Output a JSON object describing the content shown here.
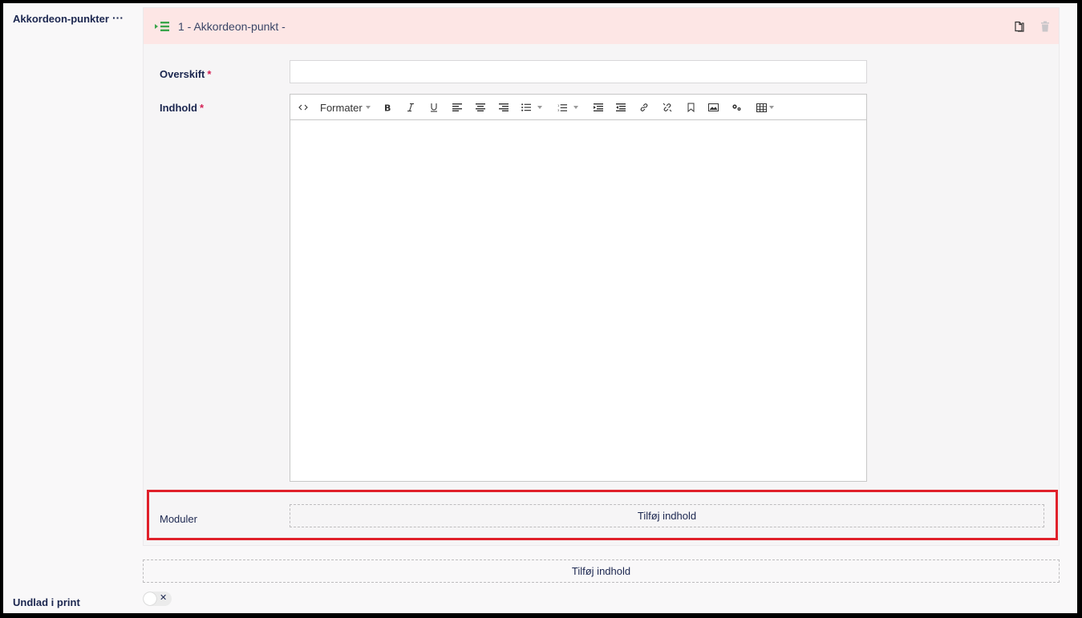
{
  "property": {
    "label": "Akkordeon-punkter",
    "more_label": "···"
  },
  "block": {
    "title": "1 - Akkordeon-punkt -",
    "fields": {
      "heading_label": "Overskift",
      "content_label": "Indhold",
      "required_mark": "*",
      "heading_value": "",
      "modules_label": "Moduler"
    },
    "editor": {
      "format_label": "Formater"
    },
    "add_content_label": "Tilføj indhold"
  },
  "outer_add_content_label": "Tilføj indhold",
  "exclude_print": {
    "label": "Undlad i print",
    "toggle_symbol": "✕",
    "checked": false
  },
  "colors": {
    "header_bg": "#fde6e5",
    "highlight": "#e0202a",
    "accent_green": "#3aa54b",
    "text": "#1b264f",
    "required": "#d42054"
  },
  "icons": {
    "block_icon": "list-icon",
    "copy": "copy-icon",
    "delete": "trash-icon"
  }
}
